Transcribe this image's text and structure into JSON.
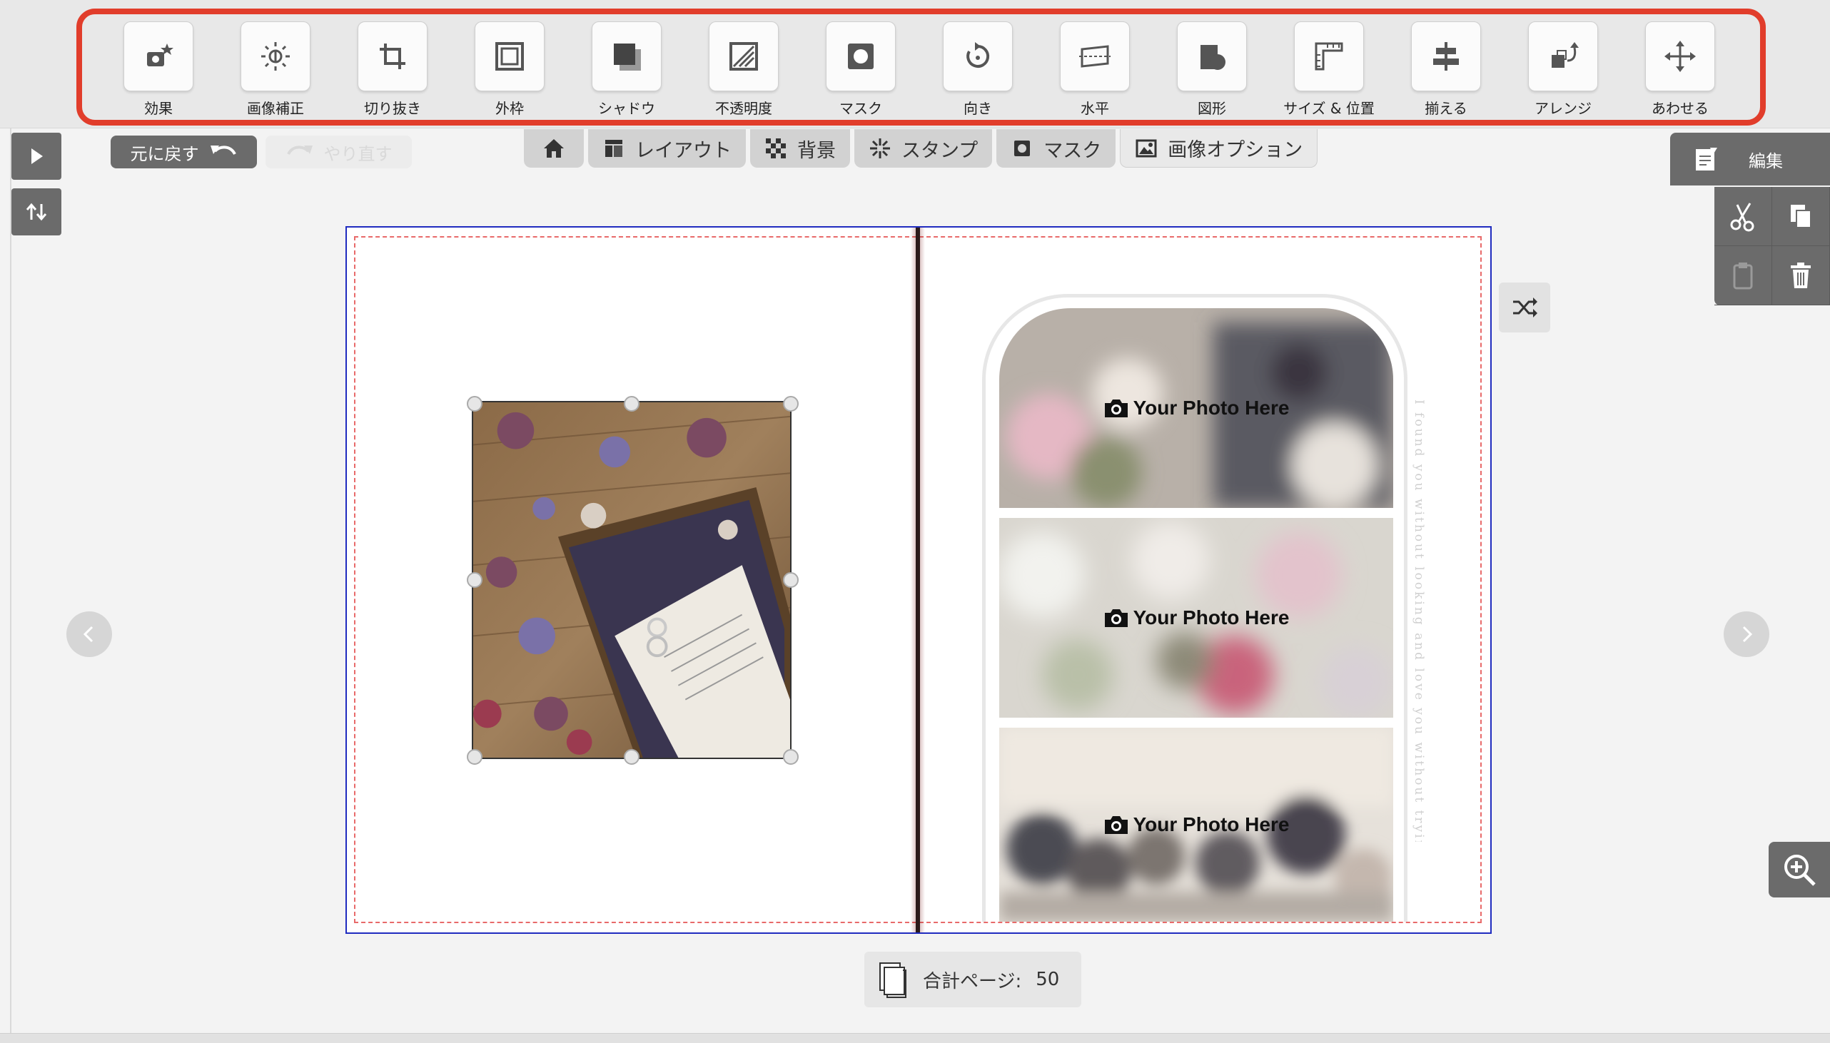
{
  "toolbar": {
    "tools": [
      {
        "label": "効果",
        "icon": "effect-icon"
      },
      {
        "label": "画像補正",
        "icon": "brightness-icon"
      },
      {
        "label": "切り抜き",
        "icon": "crop-icon"
      },
      {
        "label": "外枠",
        "icon": "frame-icon"
      },
      {
        "label": "シャドウ",
        "icon": "shadow-icon"
      },
      {
        "label": "不透明度",
        "icon": "opacity-icon"
      },
      {
        "label": "マスク",
        "icon": "mask-icon"
      },
      {
        "label": "向き",
        "icon": "rotate-icon"
      },
      {
        "label": "水平",
        "icon": "level-icon"
      },
      {
        "label": "図形",
        "icon": "shape-icon"
      },
      {
        "label": "サイズ & 位置",
        "icon": "size-position-icon"
      },
      {
        "label": "揃える",
        "icon": "align-icon"
      },
      {
        "label": "アレンジ",
        "icon": "arrange-icon"
      },
      {
        "label": "あわせる",
        "icon": "fit-icon"
      }
    ],
    "highlight_color": "#e13d2b"
  },
  "history": {
    "undo_label": "元に戻す",
    "redo_label": "やり直す"
  },
  "subtabs": {
    "layout": "レイアウト",
    "background": "背景",
    "stamp": "スタンプ",
    "mask": "マスク",
    "image_options": "画像オプション"
  },
  "edit_panel": {
    "title": "編集"
  },
  "canvas": {
    "placeholder_text": "Your Photo Here",
    "vertical_text": "I found you without looking and love you without trying"
  },
  "footer": {
    "page_count_label": "合計ページ:",
    "page_count": "50"
  }
}
